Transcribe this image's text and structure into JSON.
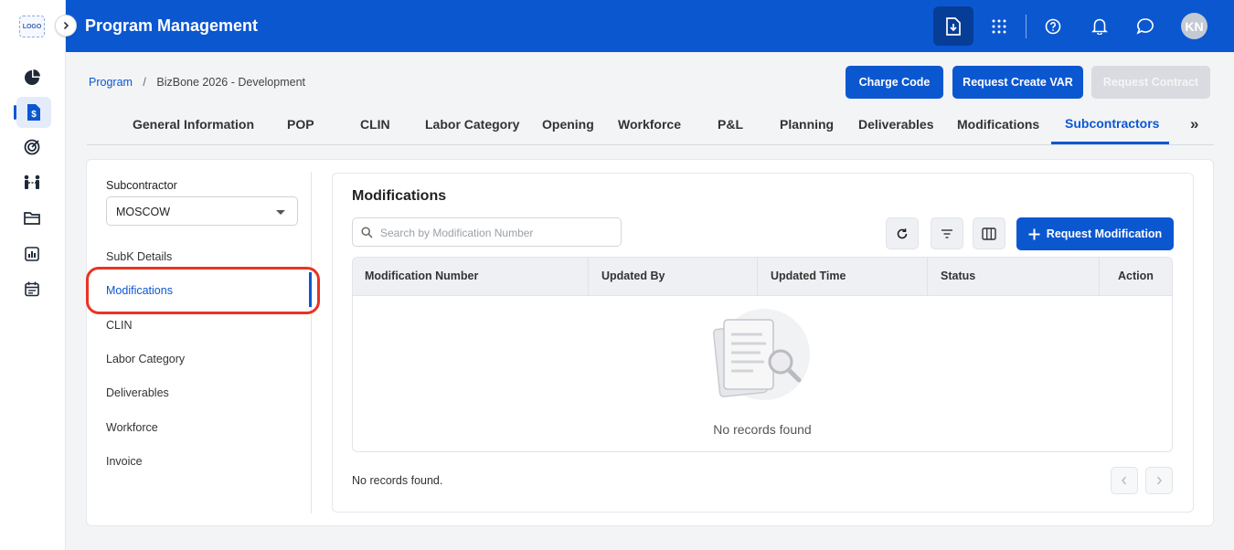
{
  "app": {
    "logo_text": "LOGO",
    "title": "Program Management",
    "avatar_initials": "KN",
    "accent": "#0b57d0"
  },
  "rail": {
    "items": [
      "dashboard-icon",
      "finance-doc-icon",
      "target-icon",
      "team-icon",
      "folder-icon",
      "report-icon",
      "calendar-icon"
    ],
    "active_index": 1
  },
  "topbar": {
    "icons": [
      "download-doc-icon",
      "apps-grid-icon",
      "help-icon",
      "bell-icon",
      "chat-icon"
    ]
  },
  "breadcrumb": {
    "root": "Program",
    "separator": "/",
    "current": "BizBone 2026 - Development"
  },
  "actions": {
    "charge_code": "Charge Code",
    "request_var": "Request Create VAR",
    "request_contract": "Request Contract"
  },
  "tabs": [
    "General Information",
    "POP",
    "CLIN",
    "Labor Category",
    "Opening",
    "Workforce",
    "P&L",
    "Planning",
    "Deliverables",
    "Modifications",
    "Subcontractors"
  ],
  "active_tab": "Subcontractors",
  "more_tabs": "»",
  "sidebar": {
    "subcontractor_label": "Subcontractor",
    "subcontractor_value": "MOSCOW",
    "items": [
      "SubK Details",
      "Modifications",
      "CLIN",
      "Labor Category",
      "Deliverables",
      "Workforce",
      "Invoice"
    ],
    "active_item": "Modifications"
  },
  "panel": {
    "title": "Modifications",
    "search_placeholder": "Search by Modification Number",
    "request_button": "Request Modification",
    "columns": [
      "Modification Number",
      "Updated By",
      "Updated Time",
      "Status",
      "Action"
    ],
    "rows": [],
    "empty_message": "No records found",
    "footer_text": "No records found."
  }
}
